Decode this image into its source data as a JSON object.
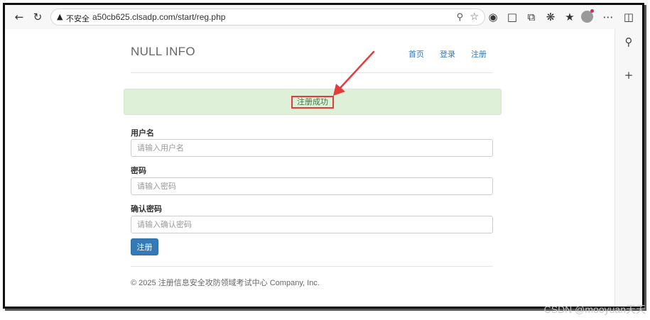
{
  "browser": {
    "security_icon": "warning-triangle-icon",
    "security_label": "不安全",
    "url": "a50cb625.clsadp.com/start/reg.php"
  },
  "site": {
    "brand": "NULL INFO",
    "nav": [
      "首页",
      "登录",
      "注册"
    ]
  },
  "alert": {
    "message": "注册成功",
    "highlight_color": "#e43c3c",
    "bg_color": "#dff0d8"
  },
  "form": {
    "username_label": "用户名",
    "username_placeholder": "请输入用户名",
    "password_label": "密码",
    "password_placeholder": "请输入密码",
    "confirm_label": "确认密码",
    "confirm_placeholder": "请输入确认密码",
    "submit_label": "注册",
    "submit_color": "#337ab7"
  },
  "footer": {
    "text": "© 2025 注册信息安全攻防领域考试中心 Company, Inc."
  },
  "watermark": "CSDN @mooyuan天天"
}
